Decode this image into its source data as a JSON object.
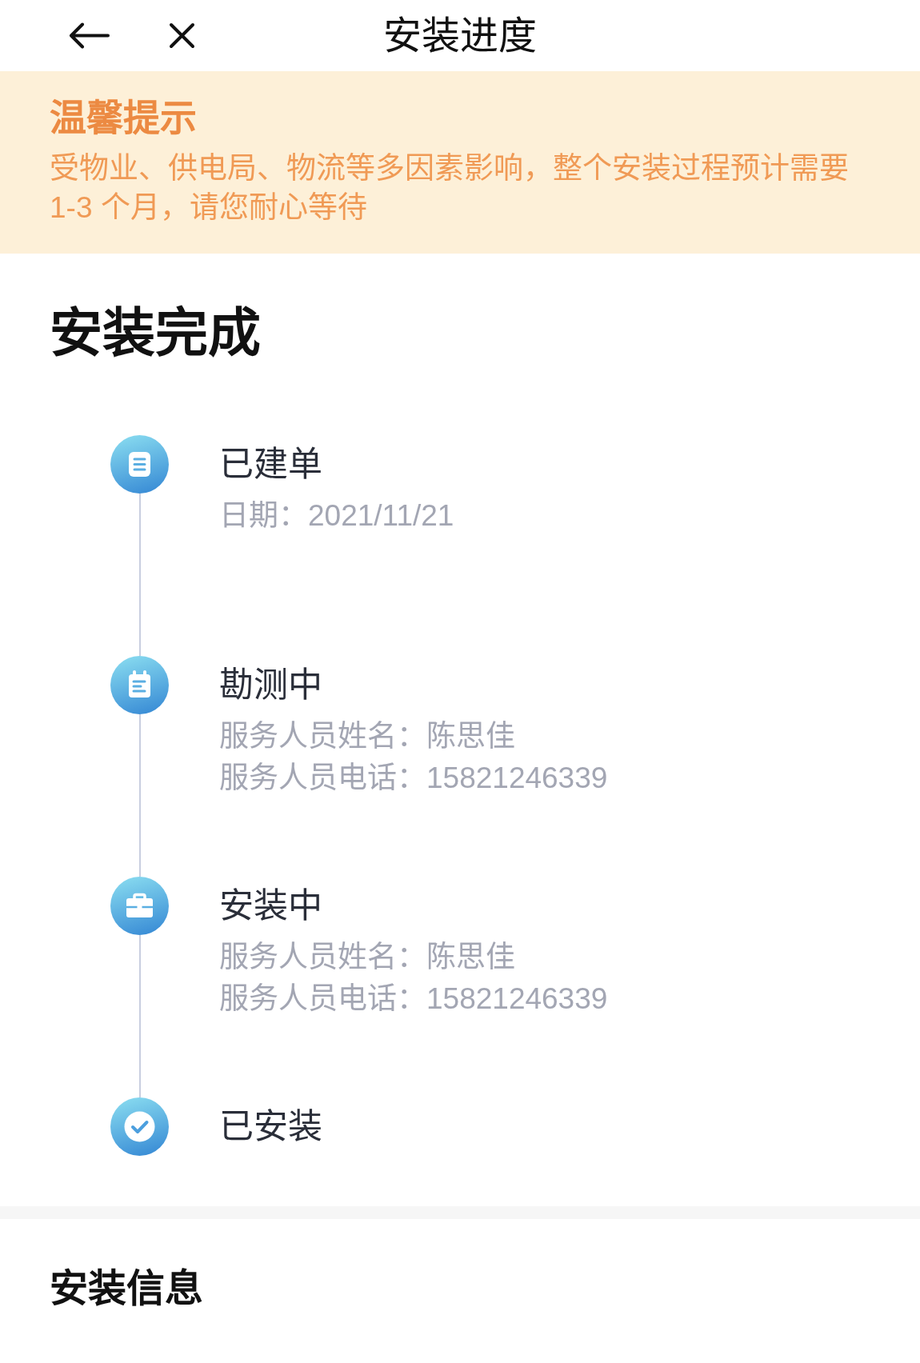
{
  "nav": {
    "title": "安装进度"
  },
  "notice": {
    "title": "温馨提示",
    "text": "受物业、供电局、物流等多因素影响，整个安装过程预计需要1-3 个月，请您耐心等待"
  },
  "status_heading": "安装完成",
  "timeline": [
    {
      "kind": "created",
      "title": "已建单",
      "details": [
        "日期：2021/11/21"
      ]
    },
    {
      "kind": "surveying",
      "title": "勘测中",
      "details": [
        "服务人员姓名：陈思佳",
        "服务人员电话：15821246339"
      ]
    },
    {
      "kind": "installing",
      "title": "安装中",
      "details": [
        "服务人员姓名：陈思佳",
        "服务人员电话：15821246339"
      ]
    },
    {
      "kind": "installed",
      "title": "已安装"
    }
  ],
  "info_section": {
    "title": "安装信息"
  }
}
